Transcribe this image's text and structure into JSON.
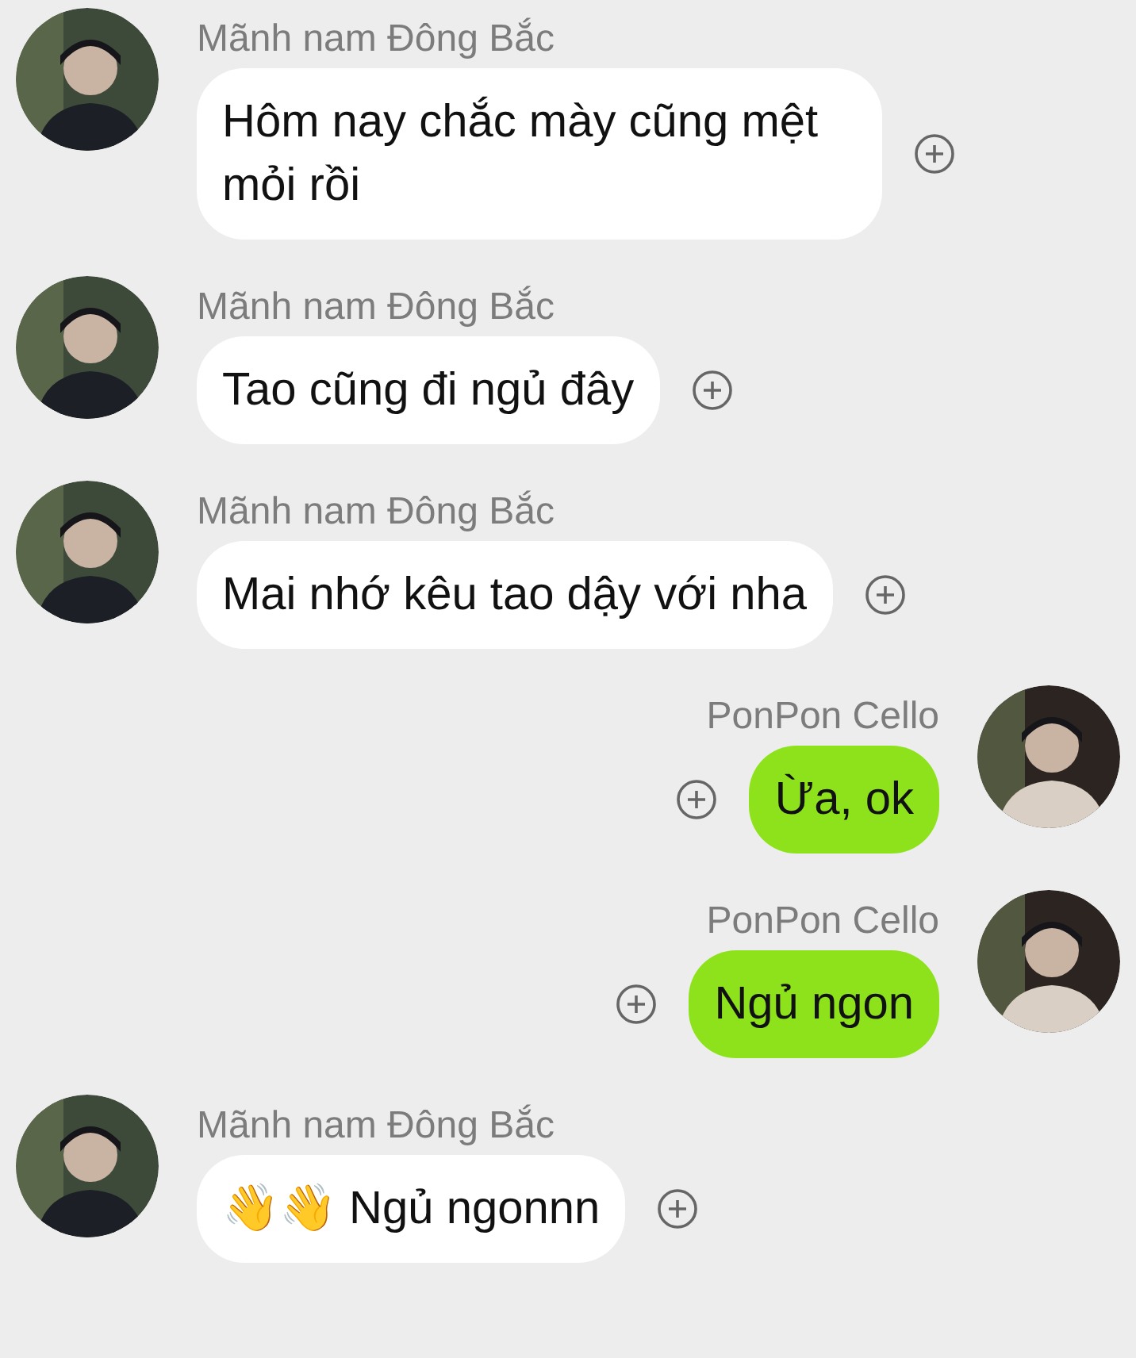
{
  "messages": [
    {
      "kind": "incoming",
      "sender": "Mãnh nam Đông Bắc",
      "text": "Hôm nay chắc mày cũng mệt mỏi rồi"
    },
    {
      "kind": "incoming",
      "sender": "Mãnh nam Đông Bắc",
      "text": "Tao cũng đi ngủ đây"
    },
    {
      "kind": "incoming",
      "sender": "Mãnh nam Đông Bắc",
      "text": "Mai nhớ kêu tao dậy với nha"
    },
    {
      "kind": "outgoing",
      "sender": "PonPon Cello",
      "text": "Ừa, ok"
    },
    {
      "kind": "outgoing",
      "sender": "PonPon Cello",
      "text": "Ngủ ngon"
    },
    {
      "kind": "incoming",
      "sender": "Mãnh nam Đông Bắc",
      "text": "👋👋 Ngủ ngonnn"
    }
  ]
}
